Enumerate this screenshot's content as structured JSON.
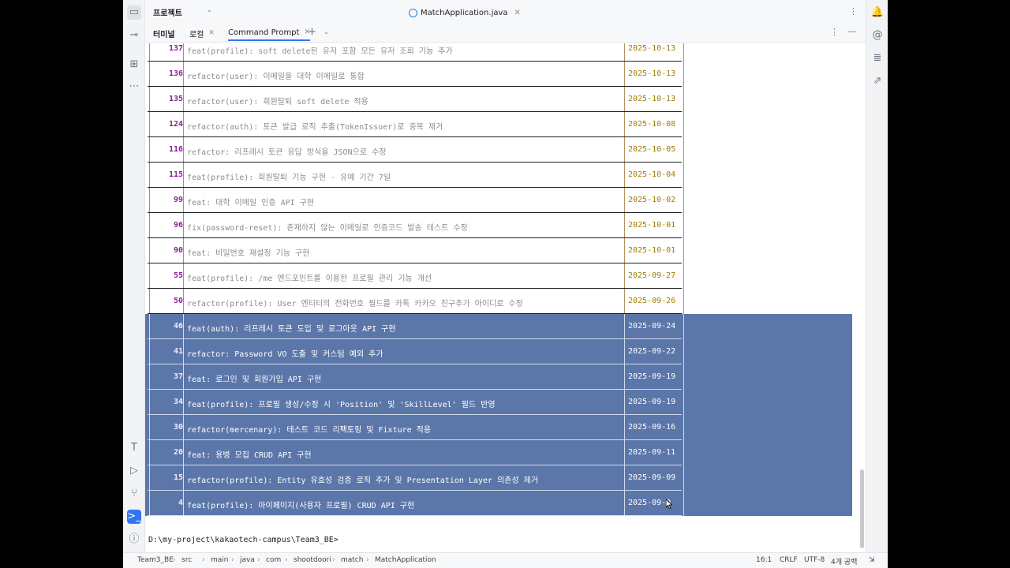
{
  "topbar": {
    "project_label": "프로젝트",
    "editor_tab": "MatchApplication.java"
  },
  "terminal_tabs": [
    {
      "label": "터미널"
    },
    {
      "label": "로컬"
    },
    {
      "label": "Command Prompt"
    }
  ],
  "rows": [
    {
      "num": "137",
      "msg": "feat(profile): soft delete된 유저 포함 모든 유저 조회 기능 추가",
      "date": "2025-10-13",
      "selected": false
    },
    {
      "num": "136",
      "msg": "refactor(user): 이메일을 대학 이메일로 통합",
      "date": "2025-10-13",
      "selected": false
    },
    {
      "num": "135",
      "msg": "refactor(user): 회원탈퇴 soft delete 적용",
      "date": "2025-10-13",
      "selected": false
    },
    {
      "num": "124",
      "msg": "refactor(auth): 토큰 발급 로직 추출(TokenIssuer)로 중복 제거",
      "date": "2025-10-08",
      "selected": false
    },
    {
      "num": "116",
      "msg": "refactor: 리프레시 토큰 응답 방식을 JSON으로 수정",
      "date": "2025-10-05",
      "selected": false
    },
    {
      "num": "115",
      "msg": "feat(profile): 회원탈퇴 기능 구현 - 유예 기간 7일",
      "date": "2025-10-04",
      "selected": false
    },
    {
      "num": "99",
      "msg": "feat: 대학 이메일 인증 API 구현",
      "date": "2025-10-02",
      "selected": false
    },
    {
      "num": "96",
      "msg": "fix(password-reset): 존재하지 않는 이메일로 인증코드 발송 테스트 수정",
      "date": "2025-10-01",
      "selected": false
    },
    {
      "num": "90",
      "msg": "feat: 비밀번호 재설정 기능 구현",
      "date": "2025-10-01",
      "selected": false
    },
    {
      "num": "55",
      "msg": "feat(profile): /me 엔드포인트를 이용한 프로필 관리 기능 개선",
      "date": "2025-09-27",
      "selected": false
    },
    {
      "num": "50",
      "msg": "refactor(profile): User 엔티티의 전화번호 필드를 카톡 카카오 친구추가 아이디로 수정",
      "date": "2025-09-26",
      "selected": false
    },
    {
      "num": "46",
      "msg": "feat(auth): 리프레시 토큰 도입 및 로그아웃 API 구현",
      "date": "2025-09-24",
      "selected": true
    },
    {
      "num": "41",
      "msg": "refactor: Password VO 도출 및 커스텀 예외 추가",
      "date": "2025-09-22",
      "selected": true
    },
    {
      "num": "37",
      "msg": "feat: 로그인 및 회원가입 API 구현",
      "date": "2025-09-19",
      "selected": true
    },
    {
      "num": "34",
      "msg": "feat(profile): 프로필 생성/수정 시 'Position' 및 'SkillLevel' 필드 반영",
      "date": "2025-09-19",
      "selected": true
    },
    {
      "num": "30",
      "msg": "refactor(mercenary): 테스트 코드 리팩토링 및 Fixture 적용",
      "date": "2025-09-16",
      "selected": true
    },
    {
      "num": "20",
      "msg": "feat: 용병 모집 CRUD API 구현",
      "date": "2025-09-11",
      "selected": true
    },
    {
      "num": "15",
      "msg": "refactor(profile): Entity 유효성 검증 로직 추가 및 Presentation Layer 의존성 제거",
      "date": "2025-09-09",
      "selected": true
    },
    {
      "num": "4",
      "msg": "feat(profile): 마이페이지(사용자 프로필) CRUD API 구현",
      "date": "2025-09-0",
      "selected": true
    }
  ],
  "prompt": "D:\\my-project\\kakaotech-campus\\Team3_BE>",
  "breadcrumbs": [
    "Team3_BE",
    "src",
    "main",
    "java",
    "com",
    "shootdoori",
    "match",
    "MatchApplication"
  ],
  "status": {
    "position": "16:1",
    "line_ending": "CRLF",
    "encoding": "UTF-8",
    "indent": "4개 공백"
  },
  "colors": {
    "selection": "#5b76a8",
    "accent": "#3574f0",
    "number": "#8a1f94",
    "date": "#a07d00"
  }
}
